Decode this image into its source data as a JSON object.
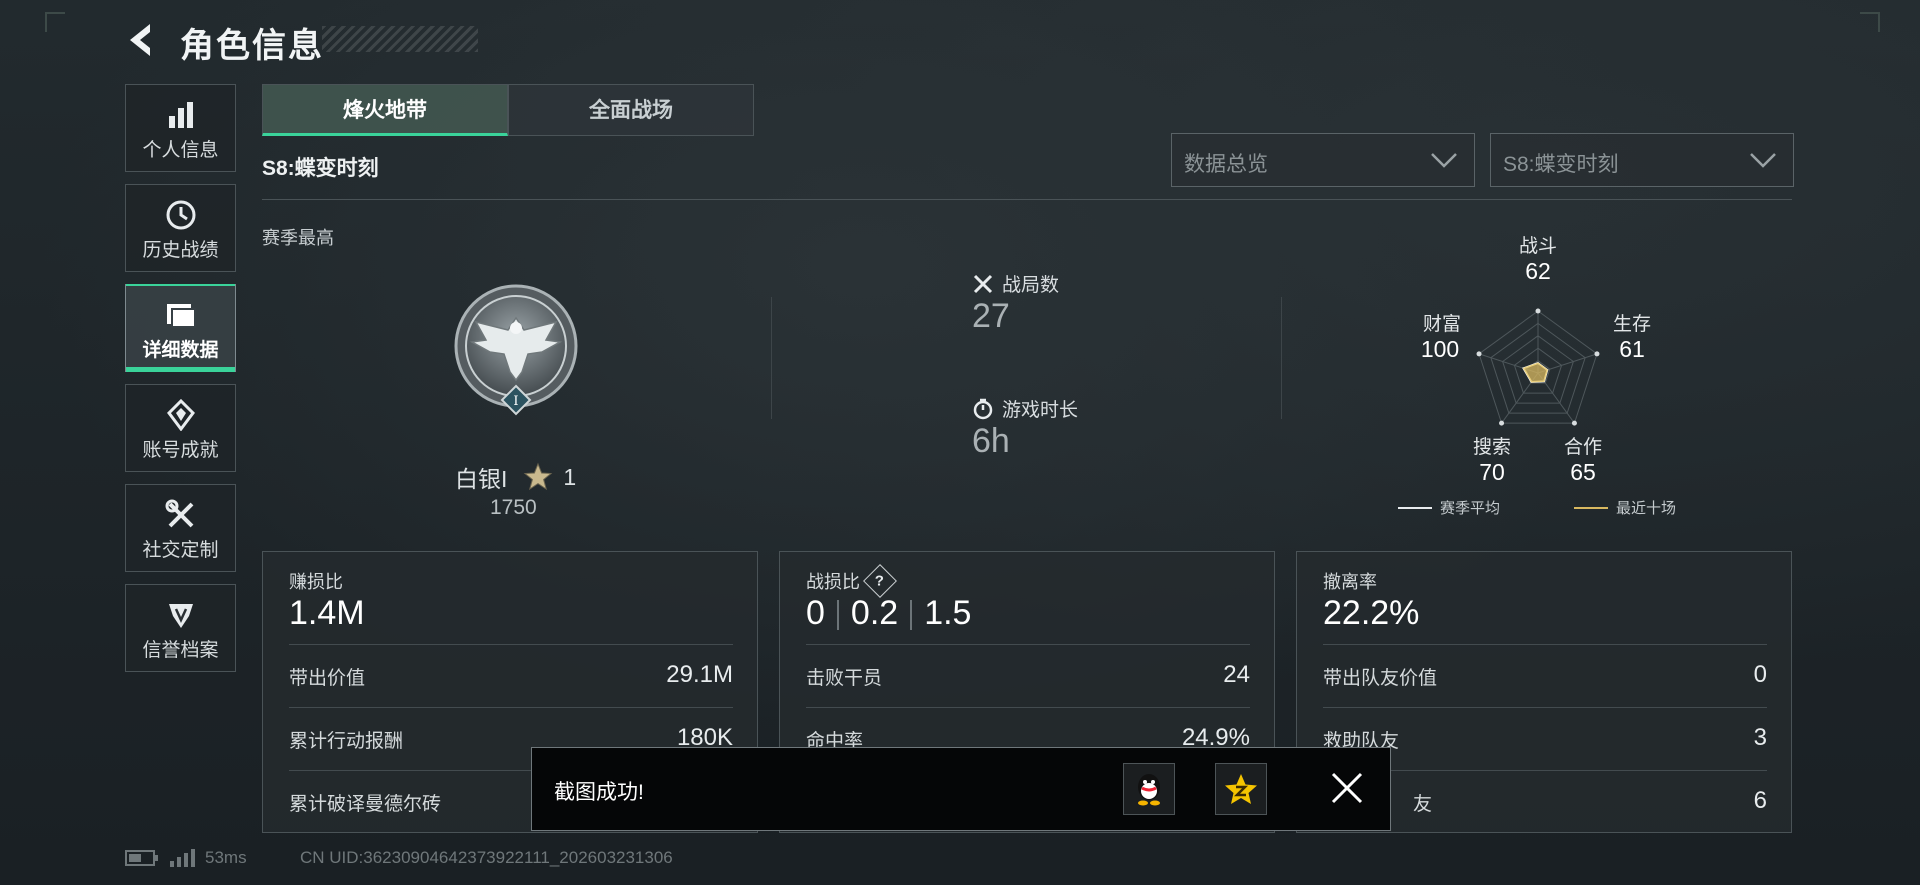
{
  "header": {
    "title": "角色信息"
  },
  "sidebar": {
    "items": [
      {
        "label": "个人信息",
        "icon": "bar-chart-icon"
      },
      {
        "label": "历史战绩",
        "icon": "clock-icon"
      },
      {
        "label": "详细数据",
        "icon": "folder-icon",
        "active": true
      },
      {
        "label": "账号成就",
        "icon": "medal-icon"
      },
      {
        "label": "社交定制",
        "icon": "tools-icon"
      },
      {
        "label": "信誉档案",
        "icon": "shield-icon"
      }
    ]
  },
  "tabs": [
    {
      "label": "烽火地带",
      "active": true
    },
    {
      "label": "全面战场",
      "active": false
    }
  ],
  "season": {
    "name": "S8:蝶变时刻"
  },
  "filters": {
    "data_type": "数据总览",
    "season": "S8:蝶变时刻"
  },
  "season_best": {
    "label": "赛季最高",
    "rank_name": "白银I",
    "stars": "1",
    "score": "1750"
  },
  "match_stats": {
    "matches_label": "战局数",
    "matches_value": "27",
    "playtime_label": "游戏时长",
    "playtime_value": "6h"
  },
  "radar": {
    "axes": [
      {
        "label": "战斗",
        "value": 62
      },
      {
        "label": "生存",
        "value": 61
      },
      {
        "label": "合作",
        "value": 65
      },
      {
        "label": "搜索",
        "value": 70
      },
      {
        "label": "财富",
        "value": 100
      }
    ],
    "legend": {
      "season_avg": "赛季平均",
      "recent_ten": "最近十场"
    },
    "colors": {
      "season_avg": "#ffffff",
      "recent_ten": "#d8b860"
    }
  },
  "cards": {
    "profit": {
      "label": "赚损比",
      "value": "1.4M",
      "rows": [
        {
          "k": "带出价值",
          "v": "29.1M"
        },
        {
          "k": "累计行动报酬",
          "v": "180K"
        },
        {
          "k": "累计破译曼德尔砖",
          "v": ""
        }
      ]
    },
    "combat": {
      "label": "战损比",
      "value_a": "0",
      "value_b": "0.2",
      "value_c": "1.5",
      "rows": [
        {
          "k": "击败干员",
          "v": "24"
        },
        {
          "k": "命中率",
          "v": "24.9%"
        }
      ]
    },
    "extract": {
      "label": "撤离率",
      "value": "22.2%",
      "rows": [
        {
          "k": "带出队友价值",
          "v": "0"
        },
        {
          "k": "救助队友",
          "v": "3"
        },
        {
          "k": "友",
          "v": "6"
        }
      ]
    }
  },
  "toast": {
    "text": "截图成功!"
  },
  "footer": {
    "ping": "53ms",
    "uid": "CN UID:36230904642373922111_202603231306"
  },
  "colors": {
    "accent": "#3ad39a",
    "background": "#1c2327"
  }
}
